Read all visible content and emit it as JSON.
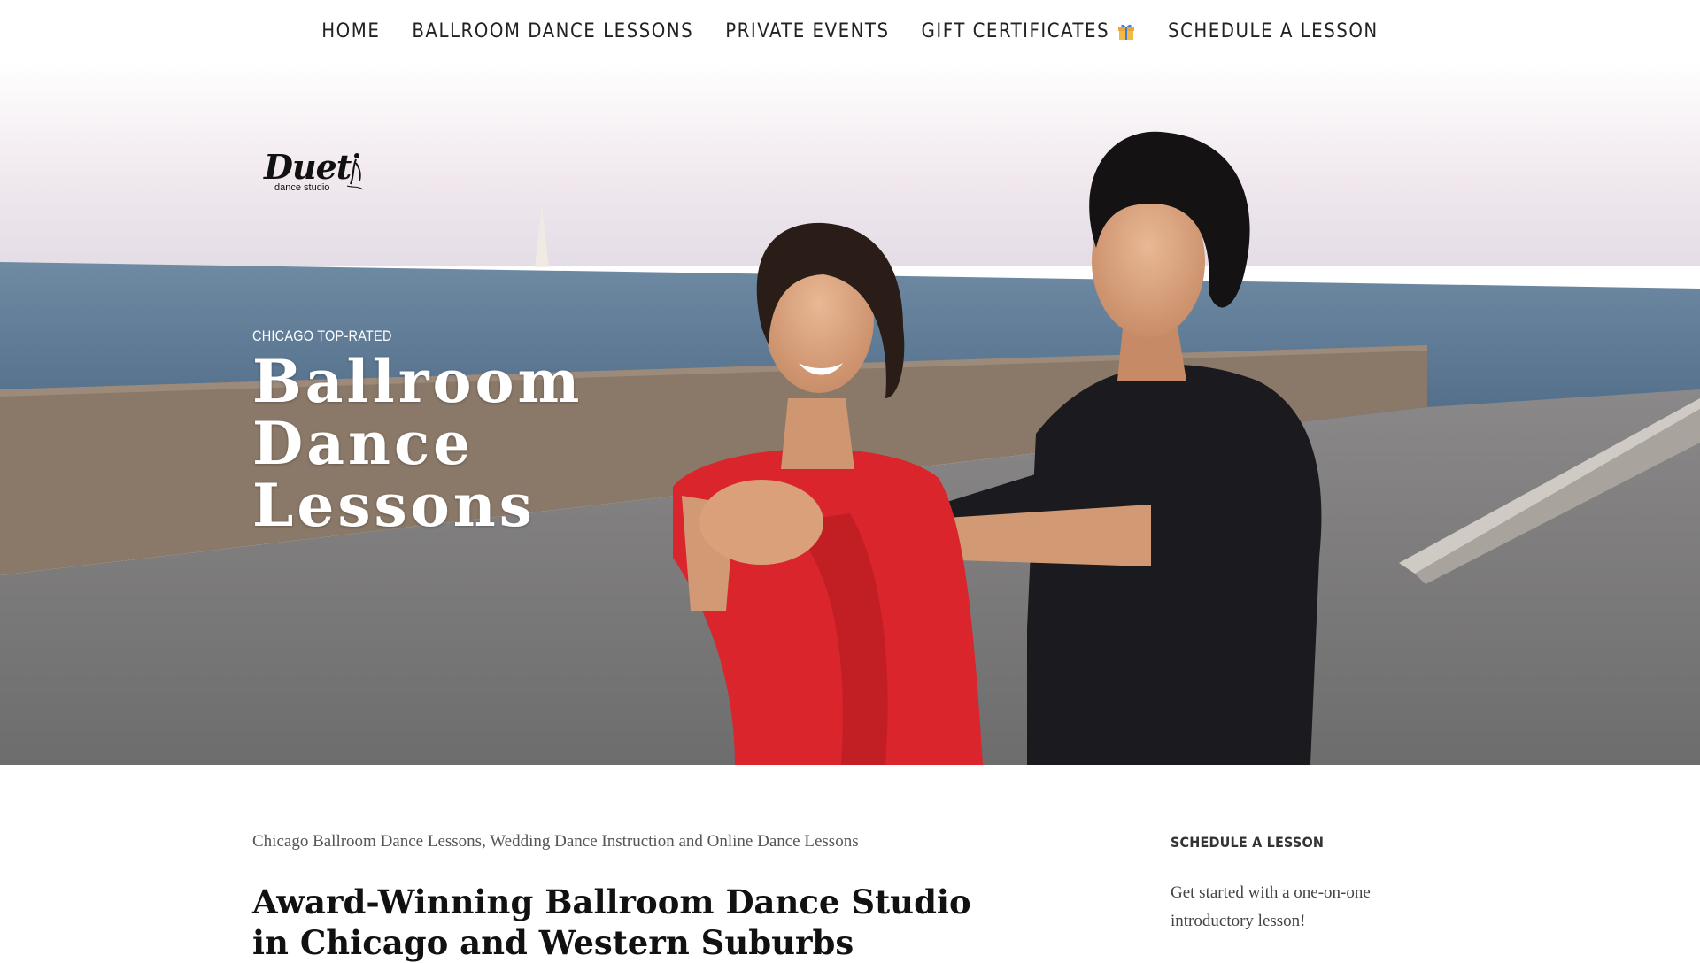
{
  "nav": {
    "items": [
      {
        "label": "HOME"
      },
      {
        "label": "BALLROOM DANCE LESSONS"
      },
      {
        "label": "PRIVATE EVENTS"
      },
      {
        "label": "GIFT CERTIFICATES"
      },
      {
        "label": "SCHEDULE A LESSON"
      }
    ],
    "gift_icon": "gift-icon"
  },
  "logo": {
    "word": "Duet",
    "sub": "dance studio"
  },
  "hero": {
    "eyebrow": "CHICAGO TOP-RATED",
    "title": "Ballroom Dance Lessons"
  },
  "content": {
    "subtitle": "Chicago Ballroom Dance Lessons, Wedding Dance Instruction and Online Dance Lessons",
    "heading": "Award-Winning Ballroom Dance Studio in Chicago and Western Suburbs"
  },
  "sidebar": {
    "heading": "SCHEDULE A LESSON",
    "text": "Get started with a one-on-one introductory lesson!"
  },
  "colors": {
    "sky": "#ece4ea",
    "water": "#5e7a95",
    "wall": "#8f7d6e",
    "pavement": "#7a7877",
    "dress": "#d9252b",
    "shirt": "#1b1a1e"
  }
}
